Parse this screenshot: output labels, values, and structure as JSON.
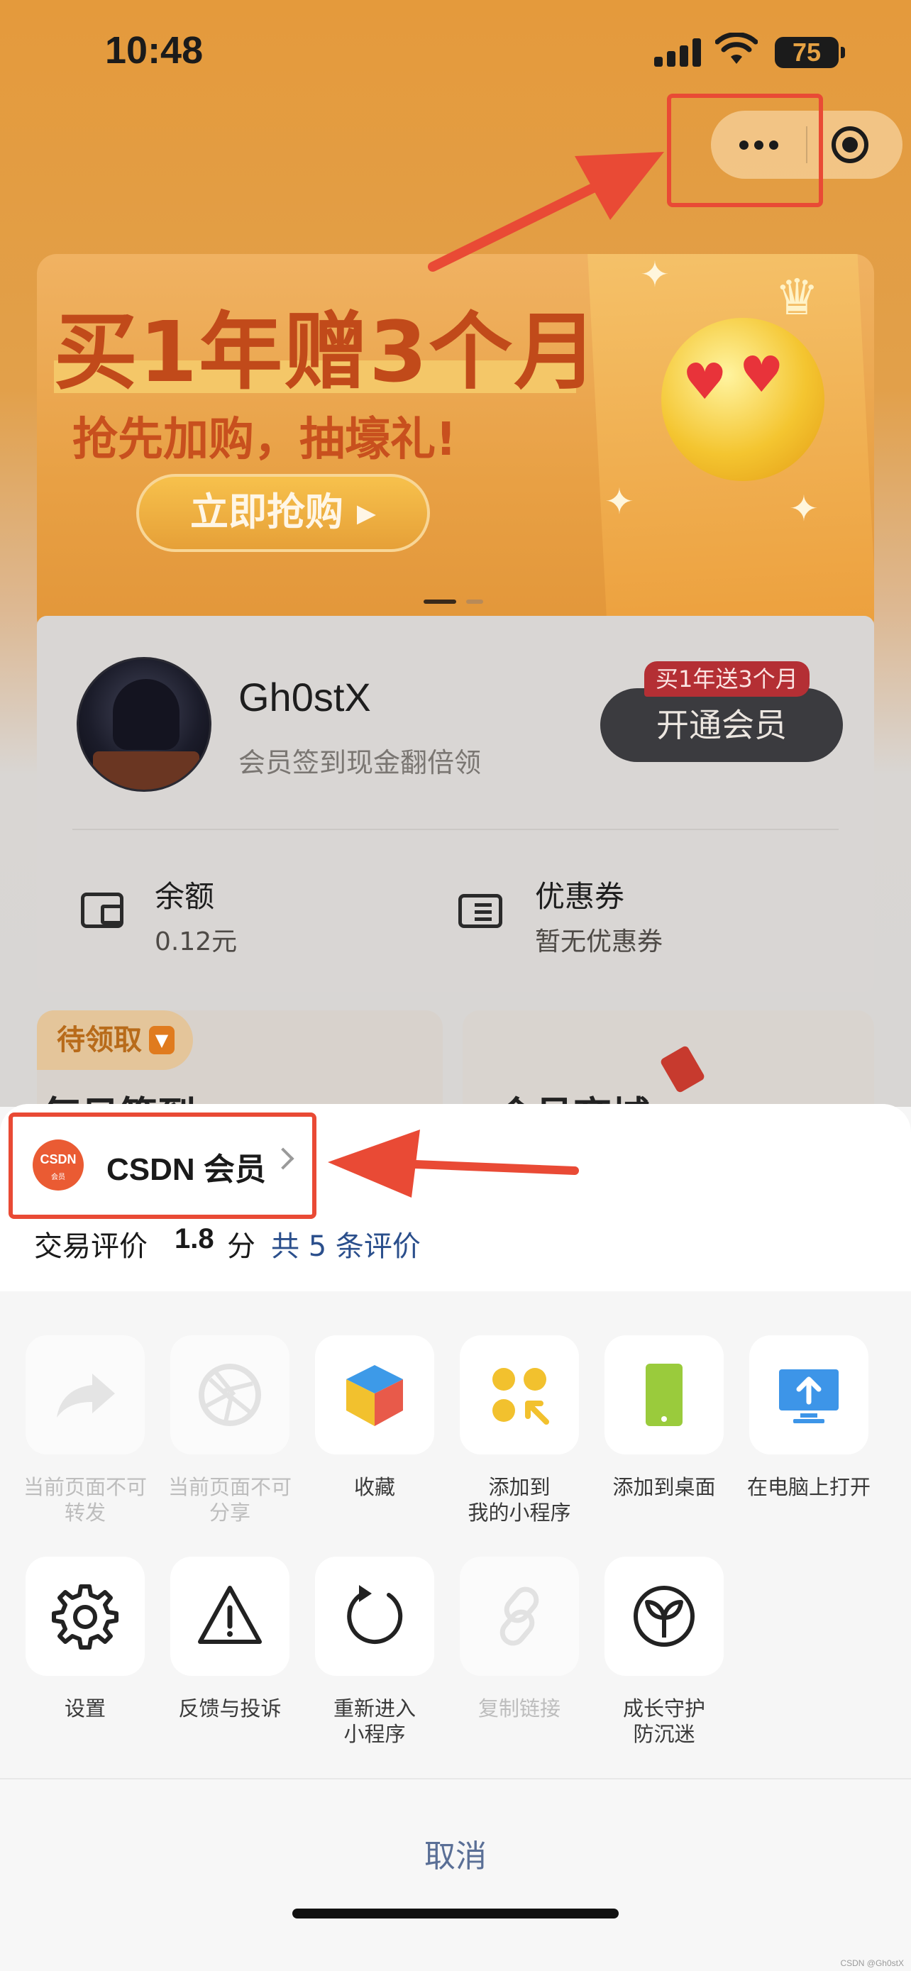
{
  "status_bar": {
    "time": "10:48",
    "battery": "75"
  },
  "banner": {
    "title": "买1年赠3个月",
    "subtitle": "抢先加购，抽壕礼!",
    "cta": "立即抢购 ▸"
  },
  "member": {
    "username": "Gh0stX",
    "slogan": "会员签到现金翻倍领",
    "open_button": "开通会员",
    "open_badge": "买1年送3个月",
    "balance_title": "余额",
    "balance_value": "0.12元",
    "coupon_title": "优惠券",
    "coupon_value": "暂无优惠券"
  },
  "lower": {
    "pending_tag": "待领取",
    "left_title": "每日签到",
    "right_title": "会员商城"
  },
  "sheet": {
    "app_logo_text": "CSDN",
    "app_logo_sub": "会员",
    "app_name": "CSDN 会员",
    "rating_label": "交易评价",
    "rating_score": "1.8",
    "rating_unit": "分",
    "rating_link": "共 5 条评价",
    "actions_row1": [
      {
        "line1": "当前页面不可",
        "line2": "转发",
        "icon": "forward-icon",
        "disabled": true
      },
      {
        "line1": "当前页面不可",
        "line2": "分享",
        "icon": "shutter-icon",
        "disabled": true
      },
      {
        "line1": "收藏",
        "line2": "",
        "icon": "cube-icon",
        "disabled": false
      },
      {
        "line1": "添加到",
        "line2": "我的小程序",
        "icon": "add-miniprogram-icon",
        "disabled": false
      },
      {
        "line1": "添加到桌面",
        "line2": "",
        "icon": "phone-icon",
        "disabled": false
      },
      {
        "line1": "在电脑上打开",
        "line2": "",
        "icon": "monitor-icon",
        "disabled": false
      }
    ],
    "actions_row2": [
      {
        "line1": "设置",
        "line2": "",
        "icon": "gear-icon",
        "disabled": false
      },
      {
        "line1": "反馈与投诉",
        "line2": "",
        "icon": "warning-icon",
        "disabled": false
      },
      {
        "line1": "重新进入",
        "line2": "小程序",
        "icon": "reload-icon",
        "disabled": false
      },
      {
        "line1": "复制链接",
        "line2": "",
        "icon": "link-icon",
        "disabled": true
      },
      {
        "line1": "成长守护",
        "line2": "防沉迷",
        "icon": "sprout-icon",
        "disabled": false
      }
    ],
    "cancel": "取消"
  },
  "colors": {
    "accent_red": "#e94a35",
    "link_blue": "#2b4f8c",
    "cancel_text": "#5a6f96",
    "desktop_green": "#9acb3c",
    "monitor_blue": "#3d95e8",
    "collect_yellow": "#f2c12e"
  },
  "watermark": "CSDN @Gh0stX"
}
